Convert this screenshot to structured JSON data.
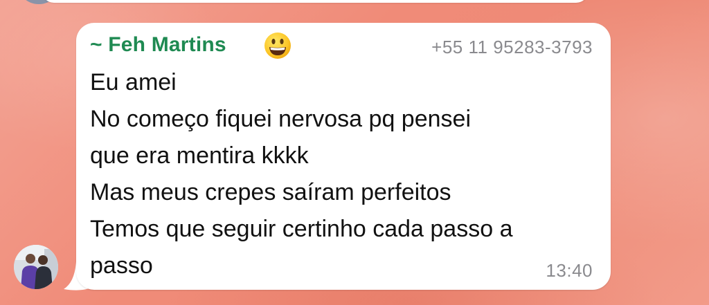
{
  "chat": {
    "message": {
      "sender_name": "~ Feh Martins",
      "sender_emoji": "grinning-face-emoji",
      "sender_phone": "+55 11 95283-3793",
      "lines": [
        "Eu amei",
        "No começo fiquei nervosa pq pensei",
        "que era mentira kkkk",
        "Mas meus crepes saíram perfeitos",
        "Temos que seguir certinho cada passo a",
        "passo"
      ],
      "time": "13:40"
    }
  },
  "colors": {
    "background": "#f08b78",
    "bubble": "#ffffff",
    "sender_name": "#1f8a52",
    "meta_text": "#8a8a8e",
    "message_text": "#111111"
  },
  "icons": {
    "avatar": "contact-avatar-photo",
    "emoji": "grinning-face-emoji"
  }
}
